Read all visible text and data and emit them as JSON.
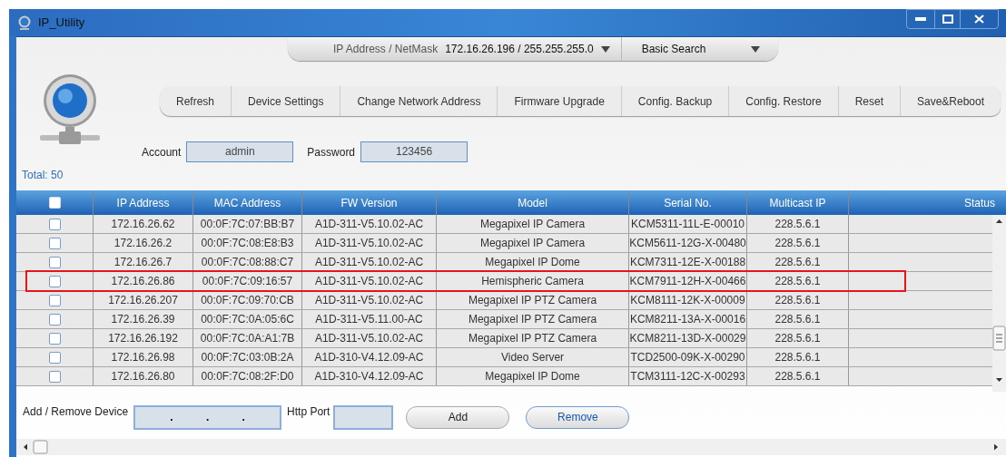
{
  "window": {
    "title": "IP_Utility"
  },
  "search_bar": {
    "label": "IP Address / NetMask",
    "value": "172.16.26.196 / 255.255.255.0",
    "mode": "Basic Search"
  },
  "toolbar": [
    "Refresh",
    "Device Settings",
    "Change Network Address",
    "Firmware Upgrade",
    "Config. Backup",
    "Config. Restore",
    "Reset",
    "Save&Reboot"
  ],
  "login": {
    "account_label": "Account",
    "account": "admin",
    "password_label": "Password",
    "password": "123456"
  },
  "total": "Total: 50",
  "table": {
    "select_all": {
      "checked": false
    },
    "columns": [
      "IP Address",
      "MAC Address",
      "FW Version",
      "Model",
      "Serial No.",
      "Multicast IP",
      "Status"
    ],
    "rows": [
      {
        "checked": false,
        "highlighted": false,
        "cells": [
          "172.16.26.62",
          "00:0F:7C:07:BB:B7",
          "A1D-311-V5.10.02-AC",
          "Megapixel IP Camera",
          "KCM5311-11L-E-00010",
          "228.5.6.1",
          ""
        ]
      },
      {
        "checked": false,
        "highlighted": false,
        "cells": [
          "172.16.26.2",
          "00:0F:7C:08:E8:B3",
          "A1D-311-V5.10.02-AC",
          "Megapixel IP Camera",
          "KCM5611-12G-X-00480",
          "228.5.6.1",
          ""
        ]
      },
      {
        "checked": false,
        "highlighted": false,
        "cells": [
          "172.16.26.7",
          "00:0F:7C:08:88:C7",
          "A1D-311-V5.10.02-AC",
          "Megapixel IP Dome",
          "KCM7311-12E-X-00188",
          "228.5.6.1",
          ""
        ]
      },
      {
        "checked": false,
        "highlighted": true,
        "cells": [
          "172.16.26.86",
          "00:0F:7C:09:16:57",
          "A1D-311-V5.10.02-AC",
          "Hemispheric Camera",
          "KCM7911-12H-X-00466",
          "228.5.6.1",
          ""
        ]
      },
      {
        "checked": false,
        "highlighted": false,
        "cells": [
          "172.16.26.207",
          "00:0F:7C:09:70:CB",
          "A1D-311-V5.10.02-AC",
          "Megapixel IP PTZ Camera",
          "KCM8111-12K-X-00009",
          "228.5.6.1",
          ""
        ]
      },
      {
        "checked": false,
        "highlighted": false,
        "cells": [
          "172.16.26.39",
          "00:0F:7C:0A:05:6C",
          "A1D-311-V5.11.00-AC",
          "Megapixel IP PTZ Camera",
          "KCM8211-13A-X-00016",
          "228.5.6.1",
          ""
        ]
      },
      {
        "checked": false,
        "highlighted": false,
        "cells": [
          "172.16.26.192",
          "00:0F:7C:0A:A1:7B",
          "A1D-311-V5.10.02-AC",
          "Megapixel IP PTZ Camera",
          "KCM8211-13D-X-00029",
          "228.5.6.1",
          ""
        ]
      },
      {
        "checked": false,
        "highlighted": false,
        "cells": [
          "172.16.26.98",
          "00:0F:7C:03:0B:2A",
          "A1D-310-V4.12.09-AC",
          "Video Server",
          "TCD2500-09K-X-00290",
          "228.5.6.1",
          ""
        ]
      },
      {
        "checked": false,
        "highlighted": false,
        "cells": [
          "172.16.26.80",
          "00:0F:7C:08:2F:D0",
          "A1D-310-V4.12.09-AC",
          "Megapixel IP Dome",
          "TCM3111-12C-X-00293",
          "228.5.6.1",
          ""
        ]
      }
    ]
  },
  "device_form": {
    "label": "Add / Remove Device",
    "ip_separators": [
      ".",
      ".",
      "."
    ],
    "port_label": "Http Port",
    "buttons": [
      {
        "label": "Add",
        "focused": false
      },
      {
        "label": "Remove",
        "focused": true
      }
    ]
  }
}
